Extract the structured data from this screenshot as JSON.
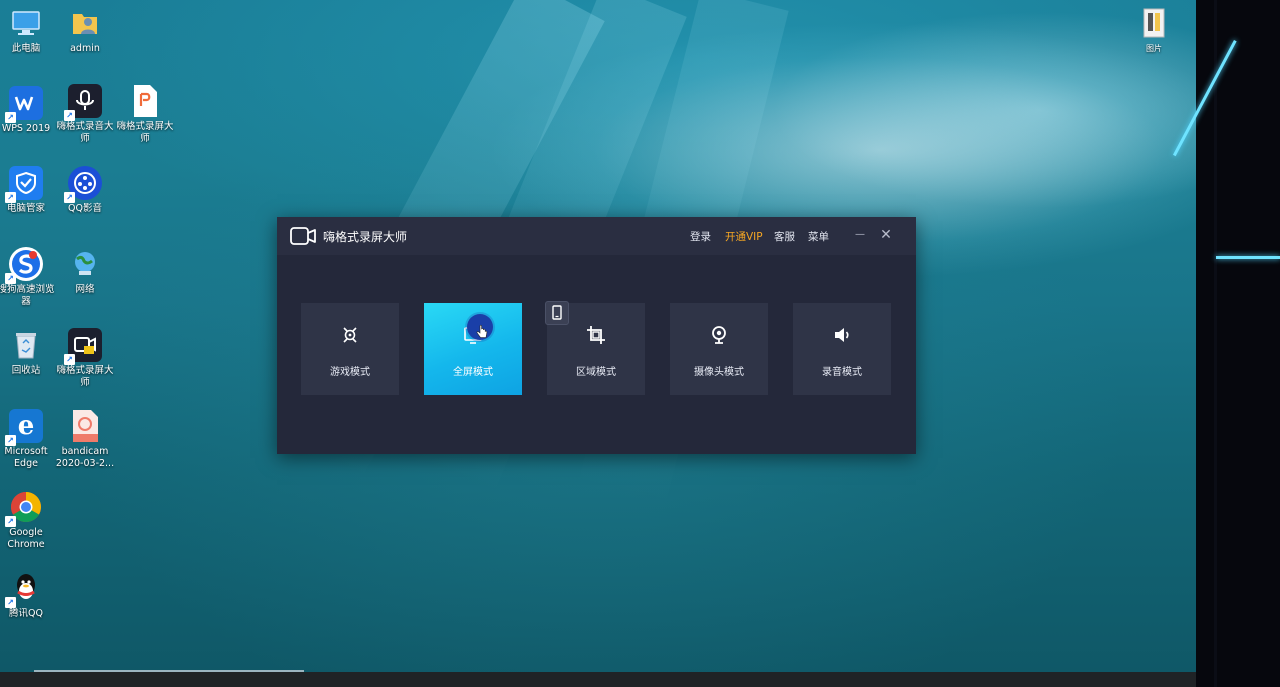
{
  "desktop": {
    "icons": [
      {
        "label": "此电脑",
        "icon": "computer-icon"
      },
      {
        "label": "admin",
        "icon": "user-folder-icon"
      },
      {
        "label": "WPS 2019",
        "icon": "wps-icon"
      },
      {
        "label": "嗨格式录音大师",
        "icon": "audio-recorder-app-icon"
      },
      {
        "label": "嗨格式录屏大师",
        "icon": "pdf-file-icon"
      },
      {
        "label": "电脑管家",
        "icon": "shield-icon"
      },
      {
        "label": "QQ影音",
        "icon": "qq-player-icon"
      },
      {
        "label": "搜狗高速浏览器",
        "icon": "sogou-browser-icon"
      },
      {
        "label": "网络",
        "icon": "network-icon"
      },
      {
        "label": "回收站",
        "icon": "recycle-bin-icon"
      },
      {
        "label": "嗨格式录屏大师",
        "icon": "screen-recorder-app-icon"
      },
      {
        "label": "Microsoft Edge",
        "icon": "edge-icon"
      },
      {
        "label": "bandicam 2020-03-2...",
        "icon": "mp4-file-icon"
      },
      {
        "label": "Google Chrome",
        "icon": "chrome-icon"
      },
      {
        "label": "腾讯QQ",
        "icon": "qq-icon"
      },
      {
        "label": "图片",
        "icon": "folder-icon"
      }
    ]
  },
  "app": {
    "title": "嗨格式录屏大师",
    "links": {
      "login": "登录",
      "vip": "开通VIP",
      "service": "客服",
      "menu": "菜单"
    },
    "minimize": "—",
    "close": "✕",
    "modes": [
      {
        "label": "游戏模式",
        "icon": "gamepad-icon",
        "active": false
      },
      {
        "label": "全屏模式",
        "icon": "fullscreen-icon",
        "active": true
      },
      {
        "label": "区域模式",
        "icon": "crop-icon",
        "active": false
      },
      {
        "label": "摄像头模式",
        "icon": "webcam-icon",
        "active": false
      },
      {
        "label": "录音模式",
        "icon": "speaker-icon",
        "active": false
      }
    ]
  },
  "colors": {
    "window_bg": "#24283a",
    "card_bg": "#2f3447",
    "active_card": "#14b7ec",
    "vip": "#f5a623"
  }
}
